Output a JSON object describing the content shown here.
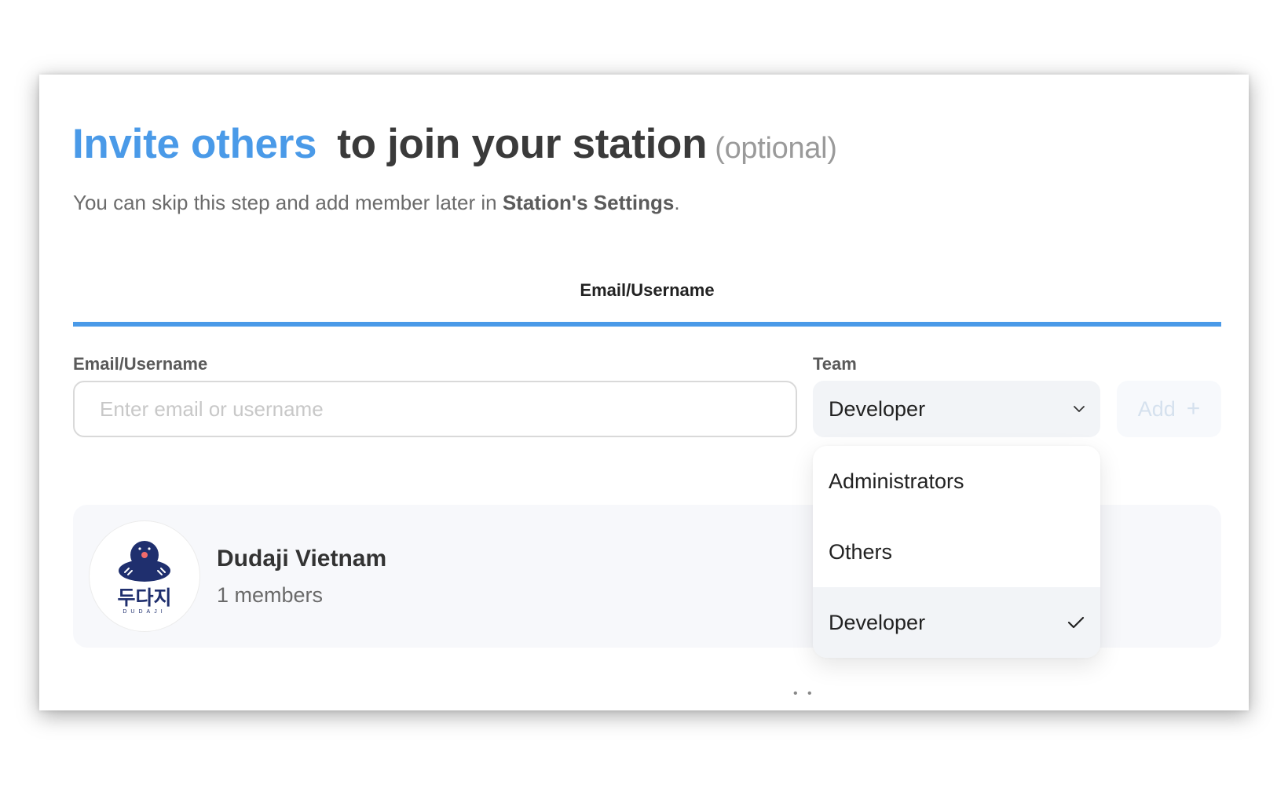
{
  "header": {
    "title_accent": "Invite others",
    "title_rest": "to join your station",
    "title_optional": "(optional)",
    "subtitle_prefix": "You can skip this step and add member later in ",
    "subtitle_link": "Station's Settings",
    "subtitle_suffix": "."
  },
  "tabs": [
    {
      "label": "Email/Username",
      "active": true
    }
  ],
  "form": {
    "email_label": "Email/Username",
    "email_placeholder": "Enter email or username",
    "email_value": "",
    "team_label": "Team",
    "team_value": "Developer",
    "add_label": "Add",
    "add_icon": "plus-icon"
  },
  "team_dropdown": {
    "options": [
      "Administrators",
      "Others",
      "Developer"
    ],
    "selected": "Developer",
    "selected_icon": "check-icon"
  },
  "member_card": {
    "name": "Dudaji Vietnam",
    "members": "1 members",
    "logo_text": "두다지",
    "logo_subtext": "DUDAJI"
  },
  "colors": {
    "accent": "#4a9ae8",
    "text_dark": "#3a3a3a",
    "muted": "#9a9a9a"
  }
}
